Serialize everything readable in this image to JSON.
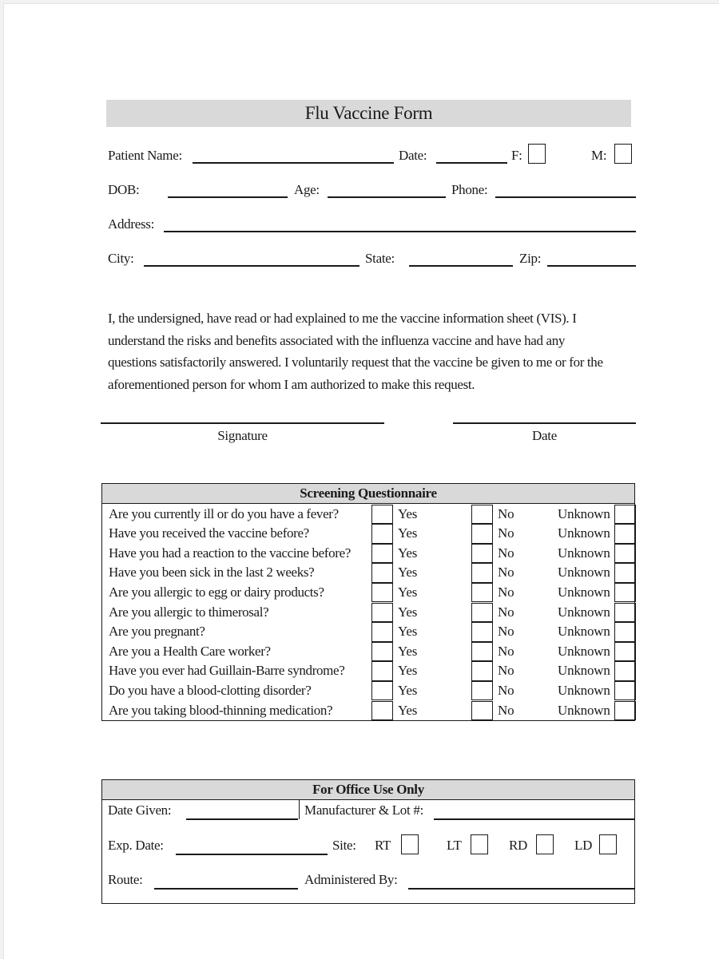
{
  "form": {
    "title": "Flu Vaccine Form",
    "patient": {
      "patient_name_label": "Patient Name:",
      "patient_name_value": "",
      "date_label": "Date:",
      "date_value": "",
      "female_label": "F:",
      "female_checked": false,
      "male_label": "M:",
      "male_checked": false,
      "dob_label": "DOB:",
      "dob_value": "",
      "age_label": "Age:",
      "age_value": "",
      "phone_label": "Phone:",
      "phone_value": "",
      "address_label": "Address:",
      "address_value": "",
      "city_label": "City:",
      "city_value": "",
      "state_label": "State:",
      "state_value": "",
      "zip_label": "Zip:",
      "zip_value": ""
    },
    "consent": {
      "lines": [
        "I, the undersigned, have read or had explained to me the vaccine information sheet (VIS). I",
        "understand the risks and benefits associated with the influenza vaccine and have had any",
        "questions satisfactorily answered. I voluntarily request that the vaccine be given to me or for the",
        "aforementioned person for whom I am authorized to make this request."
      ],
      "signature_label": "Signature",
      "date_label": "Date"
    },
    "screening": {
      "title": "Screening Questionnaire",
      "option_labels": {
        "yes": "Yes",
        "no": "No",
        "unknown": "Unknown"
      },
      "questions": [
        "Are you currently ill or do you have a fever?",
        "Have you received the vaccine before?",
        "Have you had a reaction to the vaccine before?",
        "Have you been sick in the last 2 weeks?",
        "Are you allergic to egg or dairy products?",
        "Are you allergic to thimerosal?",
        "Are you pregnant?",
        "Are you a Health Care worker?",
        "Have you ever had Guillain-Barre syndrome?",
        "Do you have a blood-clotting disorder?",
        "Are you taking blood-thinning medication?"
      ]
    },
    "office": {
      "title": "For Office Use Only",
      "date_given_label": "Date Given:",
      "manufacturer_lot_label": "Manufacturer & Lot #:",
      "exp_date_label": "Exp. Date:",
      "site_label": "Site:",
      "site_options": [
        "RT",
        "LT",
        "RD",
        "LD"
      ],
      "route_label": "Route:",
      "administered_by_label": "Administered By:"
    }
  }
}
